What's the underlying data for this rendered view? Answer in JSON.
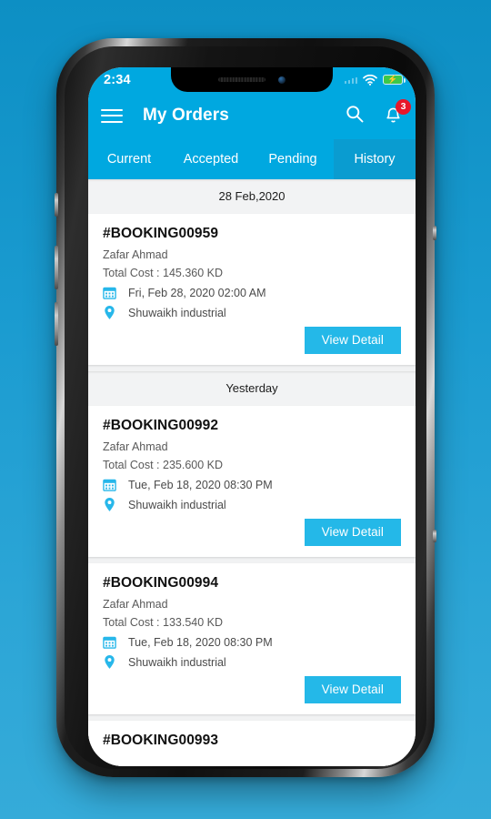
{
  "status_bar": {
    "time": "2:34",
    "wifi_icon": "wifi-icon",
    "battery_icon": "battery-charging-icon",
    "signal_icon": "signal-strength-icon"
  },
  "app_bar": {
    "menu_icon": "hamburger-menu-icon",
    "title": "My Orders",
    "search_icon": "search-icon",
    "notification_icon": "bell-icon",
    "notification_count": "3"
  },
  "tabs": [
    {
      "label": "Current",
      "active": false
    },
    {
      "label": "Accepted",
      "active": false
    },
    {
      "label": "Pending",
      "active": false
    },
    {
      "label": "History",
      "active": true
    }
  ],
  "colors": {
    "primary": "#00a8e0",
    "tab_active": "#0a9cd0",
    "button": "#24b8e8",
    "badge": "#e8172a",
    "page_bg": "#f1f2f3",
    "card_bg": "#ffffff"
  },
  "sections": [
    {
      "date_label": "28 Feb,2020",
      "orders": [
        {
          "booking_id": "#BOOKING00959",
          "customer": "Zafar Ahmad",
          "total_cost": "Total Cost : 145.360 KD",
          "datetime": "Fri, Feb 28, 2020 02:00 AM",
          "location": "Shuwaikh industrial",
          "button_label": "View Detail",
          "calendar_icon": "calendar-icon",
          "location_icon": "map-pin-icon"
        }
      ]
    },
    {
      "date_label": "Yesterday",
      "orders": [
        {
          "booking_id": "#BOOKING00992",
          "customer": "Zafar Ahmad",
          "total_cost": "Total Cost : 235.600 KD",
          "datetime": "Tue, Feb 18, 2020 08:30 PM",
          "location": "Shuwaikh industrial",
          "button_label": "View Detail",
          "calendar_icon": "calendar-icon",
          "location_icon": "map-pin-icon"
        },
        {
          "booking_id": "#BOOKING00994",
          "customer": "Zafar Ahmad",
          "total_cost": "Total Cost : 133.540 KD",
          "datetime": "Tue, Feb 18, 2020 08:30 PM",
          "location": "Shuwaikh industrial",
          "button_label": "View Detail",
          "calendar_icon": "calendar-icon",
          "location_icon": "map-pin-icon"
        },
        {
          "booking_id": "#BOOKING00993",
          "customer": "",
          "total_cost": "",
          "datetime": "",
          "location": "",
          "button_label": "",
          "partial": true
        }
      ]
    }
  ]
}
